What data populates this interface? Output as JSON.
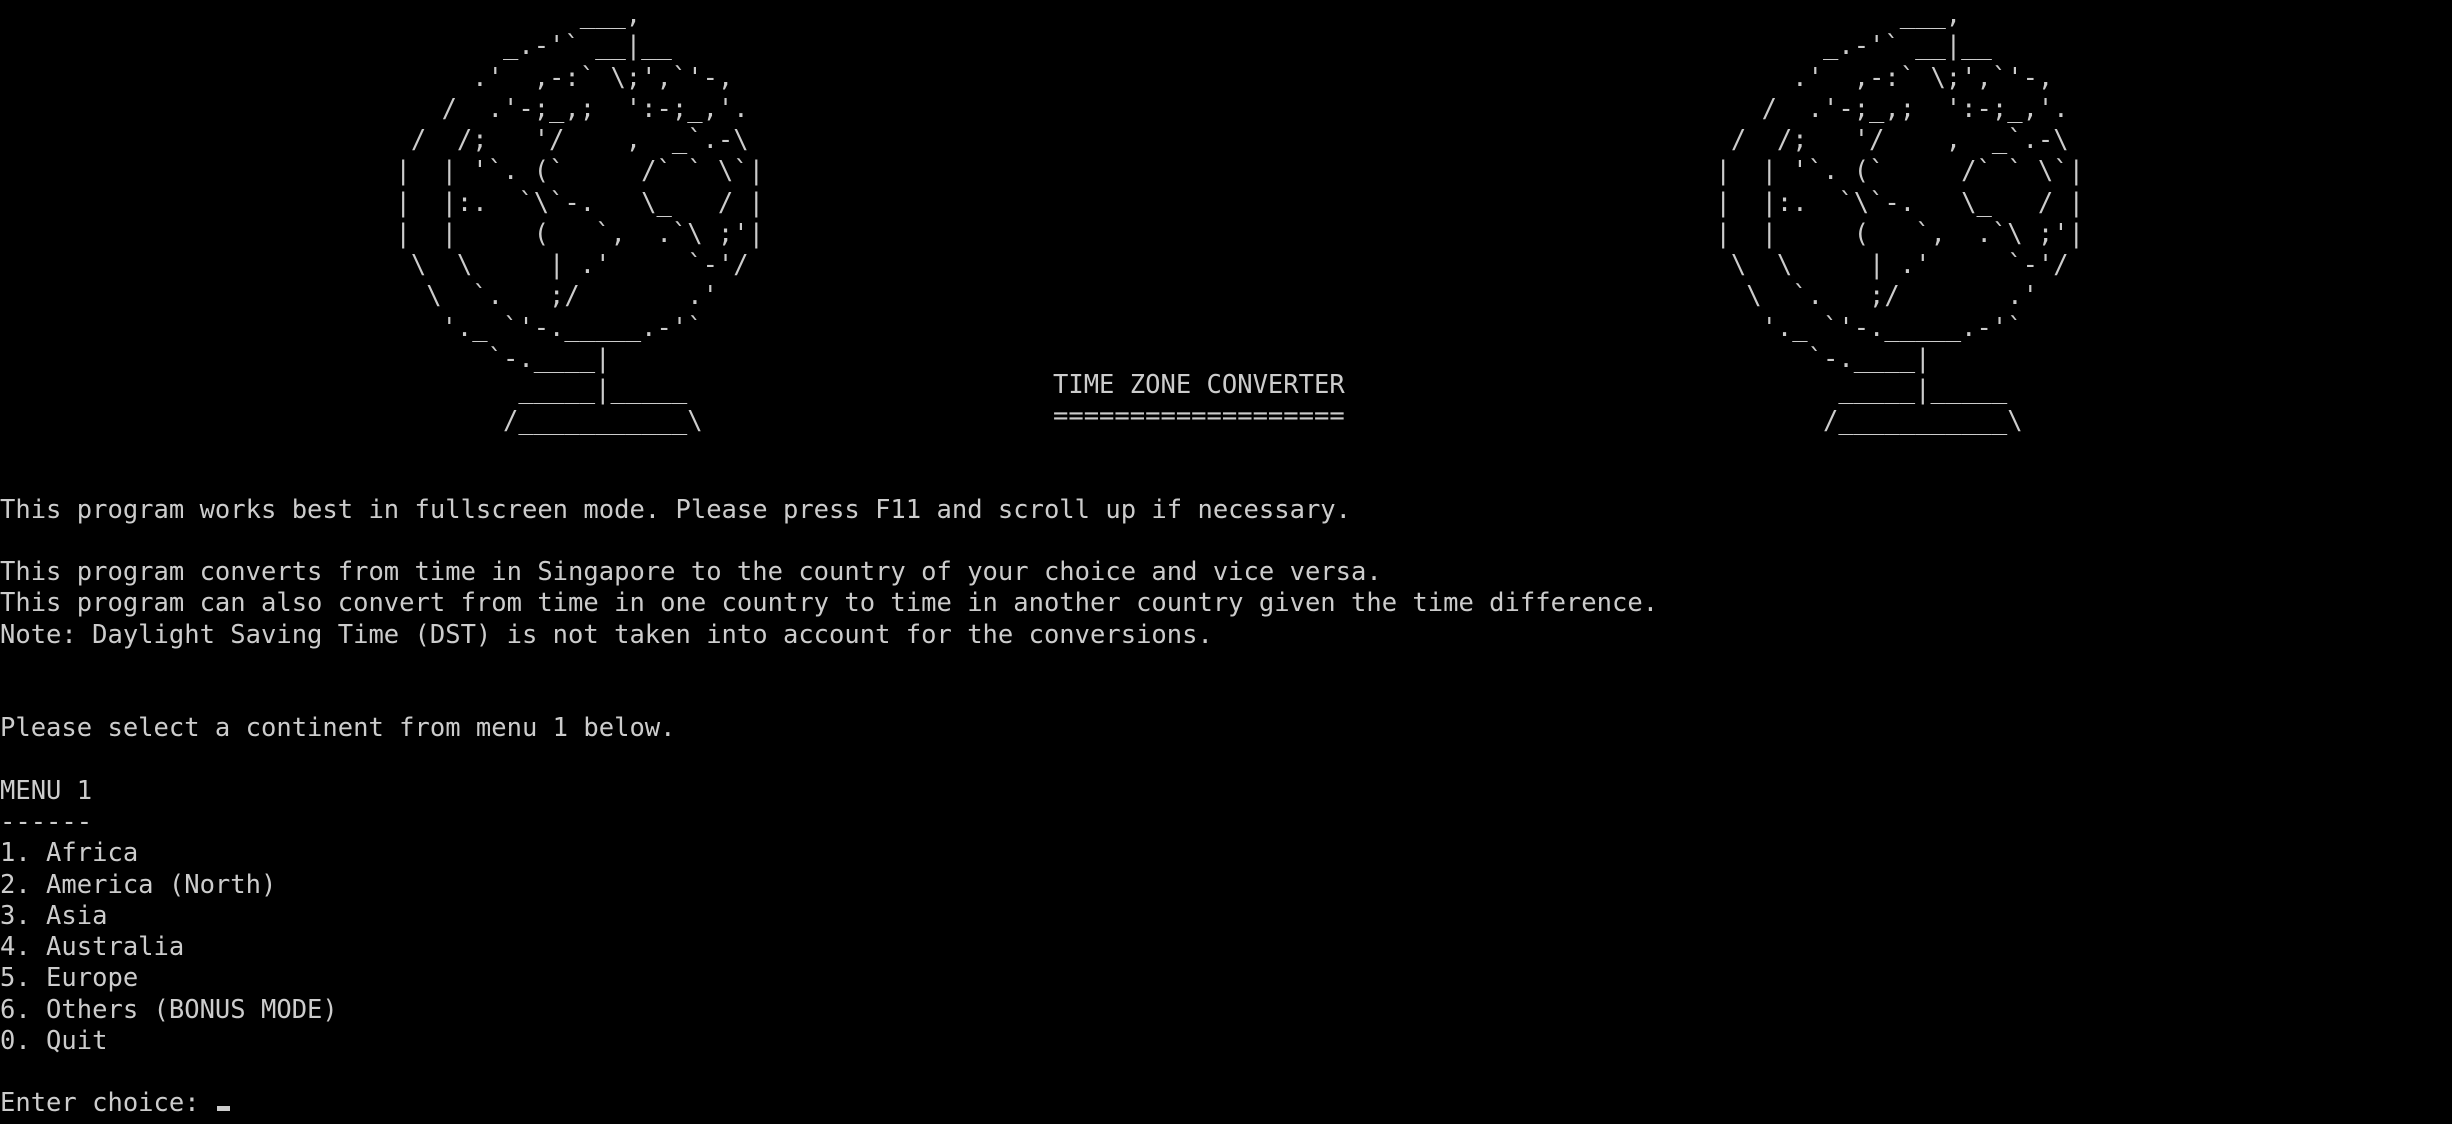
{
  "banner": {
    "globe_art": "                      ___,\n                 _.-'` __|__\n               .'  ,-:` \\;',`'-,\n             /  .'-;_,;  ':-;_,'.\n           /  /;   '/    ,  _`.-\\\n          |  | '`. (`     /` ` \\`|\n          |  |:.  `\\`-.   \\_   / |\n          |  |     (   `,  .`\\ ;'|\n           \\  \\     | .'     `-'/\n            \\  `.   ;/       .'\n             '._ `'-._____.-'`\n                `-.____|\n                  _____|_____\n                 /___________\\",
    "title": "TIME ZONE CONVERTER",
    "title_underline": "==================="
  },
  "messages": {
    "fullscreen_hint": "This program works best in fullscreen mode. Please press F11 and scroll up if necessary.",
    "description_1": "This program converts from time in Singapore to the country of your choice and vice versa.",
    "description_2": "This program can also convert from time in one country to time in another country given the time difference.",
    "note": "Note: Daylight Saving Time (DST) is not taken into account for the conversions.",
    "select_prompt": "Please select a continent from menu 1 below."
  },
  "menu": {
    "title": "MENU 1",
    "underline": "------",
    "items": [
      "1. Africa",
      "2. America (North)",
      "3. Asia",
      "4. Australia",
      "5. Europe",
      "6. Others (BONUS MODE)",
      "0. Quit"
    ]
  },
  "input": {
    "prompt": "Enter choice: ",
    "value": ""
  }
}
